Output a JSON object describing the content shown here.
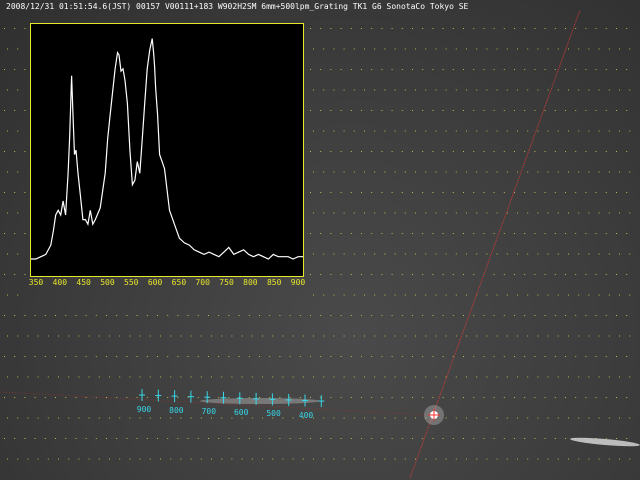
{
  "caption": "2008/12/31 01:51:54.6(JST) 00157 V00111+183 W902H2SM 6mm+500lpm_Grating TK1 G6 SonotaCo Tokyo SE",
  "colors": {
    "panel_border": "#e6e62a",
    "spectrum_line": "#ffffff",
    "marker_cyan": "#37d6e8",
    "guide_red": "#d23a3a",
    "grid_dot": "#d8d84a"
  },
  "chart_data": {
    "type": "line",
    "title": "",
    "xlabel": "",
    "ylabel": "",
    "xlim": [
      350,
      900
    ],
    "ylim": [
      0,
      100
    ],
    "grid": false,
    "x_ticks": [
      "350",
      "400",
      "450",
      "500",
      "550",
      "600",
      "650",
      "700",
      "750",
      "800",
      "850",
      "900"
    ],
    "series": [
      {
        "x": [
          350,
          360,
          370,
          380,
          390,
          395,
          400,
          405,
          410,
          415,
          420,
          425,
          428,
          432,
          435,
          438,
          441,
          445,
          450,
          455,
          460,
          465,
          470,
          475,
          480,
          490,
          500,
          505,
          510,
          515,
          520,
          525,
          528,
          532,
          536,
          540,
          545,
          550,
          555,
          560,
          565,
          570,
          575,
          580,
          585,
          590,
          595,
          598,
          600,
          602,
          606,
          610,
          615,
          620,
          625,
          630,
          640,
          650,
          660,
          670,
          680,
          690,
          700,
          710,
          720,
          730,
          740,
          750,
          760,
          770,
          780,
          790,
          800,
          810,
          820,
          830,
          840,
          850,
          860,
          870,
          880,
          890,
          900
        ],
        "y": [
          3,
          3,
          4,
          5,
          9,
          15,
          22,
          24,
          22,
          28,
          22,
          40,
          55,
          82,
          65,
          48,
          50,
          40,
          30,
          20,
          20,
          18,
          24,
          18,
          20,
          25,
          40,
          55,
          65,
          75,
          85,
          92,
          91,
          84,
          85,
          80,
          70,
          50,
          35,
          37,
          45,
          40,
          55,
          70,
          85,
          93,
          98,
          92,
          86,
          77,
          65,
          48,
          45,
          42,
          33,
          24,
          18,
          12,
          10,
          9,
          7,
          6,
          5,
          6,
          5,
          4,
          6,
          8,
          5,
          6,
          7,
          5,
          4,
          5,
          4,
          3,
          5,
          4,
          4,
          4,
          3,
          4,
          4
        ]
      }
    ]
  },
  "meteor": {
    "wavelength_labels": [
      "900",
      "800",
      "700",
      "600",
      "500",
      "400"
    ]
  }
}
